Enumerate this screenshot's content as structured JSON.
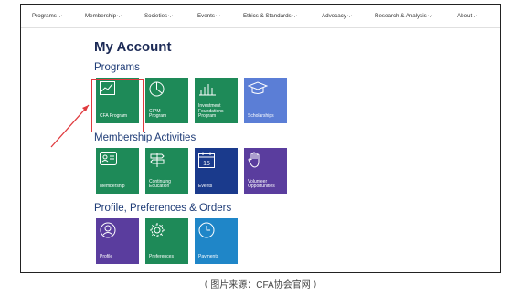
{
  "nav": {
    "items": [
      "Programs",
      "Membership",
      "Societies",
      "Events",
      "Ethics & Standards",
      "Advocacy",
      "Research & Analysis",
      "About"
    ]
  },
  "page": {
    "title": "My Account"
  },
  "sections": {
    "programs": {
      "title": "Programs",
      "tiles": [
        {
          "label": "CFA Program",
          "icon": "line-chart-icon",
          "color": "#1e8a58"
        },
        {
          "label": "CIPM\nProgram",
          "icon": "pie-chart-icon",
          "color": "#1e8a58"
        },
        {
          "label": "Investment\nFoundations\nProgram",
          "icon": "bar-chart-icon",
          "color": "#1e8a58"
        },
        {
          "label": "Scholarships",
          "icon": "graduation-cap-icon",
          "color": "#5b7ed6"
        }
      ]
    },
    "membership": {
      "title": "Membership Activities",
      "tiles": [
        {
          "label": "Membership",
          "icon": "id-card-icon",
          "color": "#1e8a58"
        },
        {
          "label": "Continuing\nEducation",
          "icon": "signpost-icon",
          "color": "#1e8a58"
        },
        {
          "label": "Events",
          "icon": "calendar-icon",
          "color": "#1a3a8c"
        },
        {
          "label": "Volunteer\nOpportunities",
          "icon": "raised-hand-icon",
          "color": "#5a3d9e"
        }
      ]
    },
    "profile": {
      "title": "Profile, Preferences & Orders",
      "tiles": [
        {
          "label": "Profile",
          "icon": "user-circle-icon",
          "color": "#5a3d9e"
        },
        {
          "label": "Preferences",
          "icon": "gear-icon",
          "color": "#1e8a58"
        },
        {
          "label": "Payments",
          "icon": "clock-icon",
          "color": "#1f86c8"
        }
      ]
    }
  },
  "calendar_day": "15",
  "caption": "（ 图片来源：CFA协会官网 ）",
  "colors": {
    "annotation": "#e03a3e",
    "title": "#1c2a56",
    "section": "#1f3c77"
  }
}
